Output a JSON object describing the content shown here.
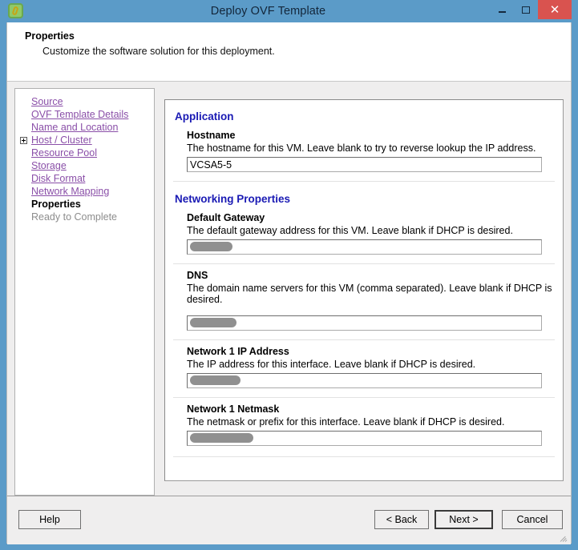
{
  "window": {
    "title": "Deploy OVF Template",
    "icon": "ovf-template-icon",
    "controls": {
      "minimize": "–",
      "maximize": "□",
      "close": "✕"
    }
  },
  "header": {
    "title": "Properties",
    "subtitle": "Customize the software solution for this deployment."
  },
  "sidebar": {
    "items": [
      {
        "label": "Source",
        "state": "link",
        "expander": false
      },
      {
        "label": "OVF Template Details",
        "state": "link",
        "expander": false
      },
      {
        "label": "Name and Location",
        "state": "link",
        "expander": false
      },
      {
        "label": "Host / Cluster",
        "state": "link",
        "expander": true
      },
      {
        "label": "Resource Pool",
        "state": "link",
        "expander": false
      },
      {
        "label": "Storage",
        "state": "link",
        "expander": false
      },
      {
        "label": "Disk Format",
        "state": "link",
        "expander": false
      },
      {
        "label": "Network Mapping",
        "state": "link",
        "expander": false
      },
      {
        "label": "Properties",
        "state": "current",
        "expander": false
      },
      {
        "label": "Ready to Complete",
        "state": "disabled",
        "expander": false
      }
    ]
  },
  "main": {
    "sections": [
      {
        "title": "Application",
        "fields": [
          {
            "label": "Hostname",
            "description": "The hostname for this VM. Leave blank to try to reverse lookup the IP address.",
            "value": "VCSA5-5",
            "redacted": false,
            "redaction_width": 0,
            "tall_gap": false
          }
        ]
      },
      {
        "title": "Networking Properties",
        "fields": [
          {
            "label": "Default Gateway",
            "description": "The default gateway address for this VM. Leave blank if DHCP is desired.",
            "value": "",
            "redacted": true,
            "redaction_width": 53,
            "tall_gap": false
          },
          {
            "label": "DNS",
            "description": "The domain name servers for this VM (comma separated). Leave blank if DHCP is desired.",
            "value": "",
            "redacted": true,
            "redaction_width": 58,
            "tall_gap": true
          },
          {
            "label": "Network 1 IP Address",
            "description": "The IP address for this interface. Leave blank if DHCP is desired.",
            "value": "",
            "redacted": true,
            "redaction_width": 63,
            "tall_gap": false
          },
          {
            "label": "Network 1 Netmask",
            "description": "The netmask or prefix for this interface. Leave blank if DHCP is desired.",
            "value": "",
            "redacted": true,
            "redaction_width": 79,
            "tall_gap": false
          }
        ]
      }
    ]
  },
  "footer": {
    "help": "Help",
    "back": "< Back",
    "next": "Next >",
    "cancel": "Cancel"
  },
  "colors": {
    "frame": "#5b9bc8",
    "section_heading": "#1a1ab4",
    "nav_link": "#8a4fa8",
    "close_button": "#d9534f",
    "redaction": "#878787"
  }
}
